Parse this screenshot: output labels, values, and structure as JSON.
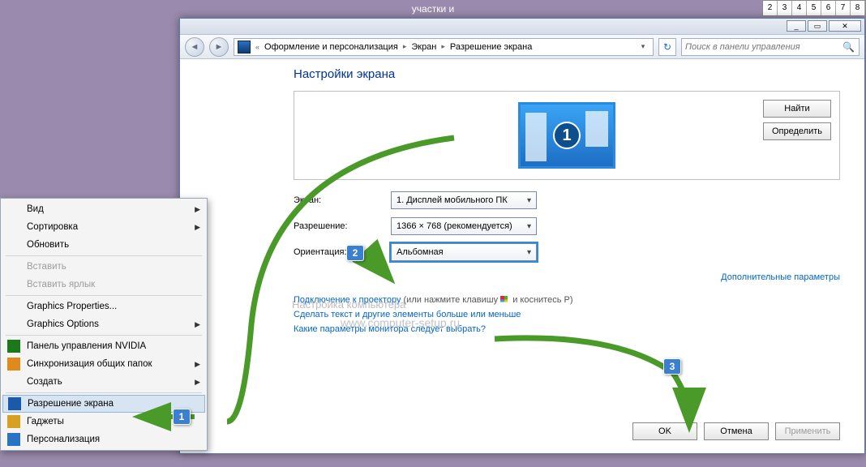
{
  "taskbar_title": "участки и",
  "ruler": [
    "2",
    "3",
    "4",
    "5",
    "6",
    "7",
    "8"
  ],
  "window_controls": {
    "min": "_",
    "max": "▭",
    "close": "✕"
  },
  "breadcrumb": {
    "prefix": "«",
    "items": [
      "Оформление и персонализация",
      "Экран",
      "Разрешение экрана"
    ]
  },
  "search_placeholder": "Поиск в панели управления",
  "heading": "Настройки экрана",
  "side_buttons": {
    "find": "Найти",
    "detect": "Определить"
  },
  "monitor_number": "1",
  "fields": {
    "screen_label": "Экран:",
    "screen_value": "1. Дисплей мобильного ПК",
    "resolution_label": "Разрешение:",
    "resolution_value": "1366 × 768 (рекомендуется)",
    "orientation_label": "Ориентация:",
    "orientation_value": "Альбомная"
  },
  "watermark_small": "Настройка компьютера",
  "watermark_url": "www.computer-setup.ru",
  "adv_link": "Дополнительные параметры",
  "line1_link": "Подключение к проектору",
  "line1_rest": " (или нажмите клавишу ",
  "line1_rest2": " и коснитесь P)",
  "line2": "Сделать текст и другие элементы больше или меньше",
  "line3": "Какие параметры монитора следует выбрать?",
  "footer": {
    "ok": "OK",
    "cancel": "Отмена",
    "apply": "Применить"
  },
  "context_menu": [
    {
      "label": "Вид",
      "sub": true
    },
    {
      "label": "Сортировка",
      "sub": true
    },
    {
      "label": "Обновить"
    },
    {
      "sep": true
    },
    {
      "label": "Вставить",
      "disabled": true
    },
    {
      "label": "Вставить ярлык",
      "disabled": true
    },
    {
      "sep": true
    },
    {
      "label": "Graphics Properties..."
    },
    {
      "label": "Graphics Options",
      "sub": true
    },
    {
      "sep": true
    },
    {
      "label": "Панель управления NVIDIA",
      "icon": "#1a7a1a"
    },
    {
      "label": "Синхронизация общих папок",
      "sub": true,
      "icon": "#e08a1a"
    },
    {
      "label": "Создать",
      "sub": true
    },
    {
      "sep": true
    },
    {
      "label": "Разрешение экрана",
      "icon": "#1a5aa8",
      "hl": true
    },
    {
      "label": "Гаджеты",
      "icon": "#d8a020"
    },
    {
      "label": "Персонализация",
      "icon": "#2a72c4"
    }
  ],
  "callouts": {
    "c1": "1",
    "c2": "2",
    "c3": "3"
  }
}
